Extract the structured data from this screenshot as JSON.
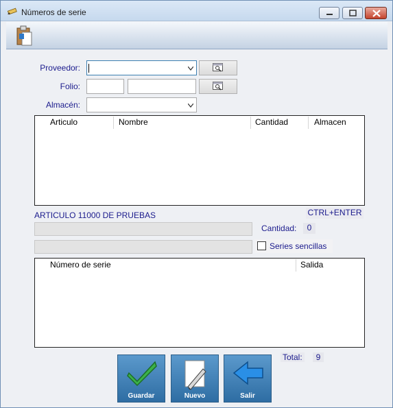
{
  "window": {
    "title": "Números de serie"
  },
  "form": {
    "proveedor_label": "Proveedor:",
    "proveedor_value": "",
    "folio_label": "Folio:",
    "folio_value_1": "",
    "folio_value_2": "",
    "almacen_label": "Almacén:",
    "almacen_value": ""
  },
  "articles_grid": {
    "columns": [
      "Articulo",
      "Nombre",
      "Cantidad",
      "Almacen"
    ],
    "rows": []
  },
  "article": {
    "title": "ARTICULO 11000 DE PRUEBAS",
    "shortcut": "CTRL+ENTER",
    "cantidad_label": "Cantidad:",
    "cantidad_value": "0",
    "series_sencillas_label": "Series sencillas",
    "series_sencillas_checked": false
  },
  "serials_grid": {
    "columns": [
      "Número de serie",
      "Salida"
    ],
    "rows": []
  },
  "totals": {
    "total_label": "Total:",
    "total_value": "9"
  },
  "actions": {
    "guardar": "Guardar",
    "nuevo": "Nuevo",
    "salir": "Salir"
  },
  "icons": {
    "title": "pencil-icon",
    "toolbar": "clipboard-icon",
    "lookup": "search-window-icon",
    "guardar": "checkmark-icon",
    "nuevo": "document-pen-icon",
    "salir": "back-arrow-icon"
  },
  "colors": {
    "label_text": "#1a1a8c",
    "button_blue": "#3f7fb6"
  }
}
